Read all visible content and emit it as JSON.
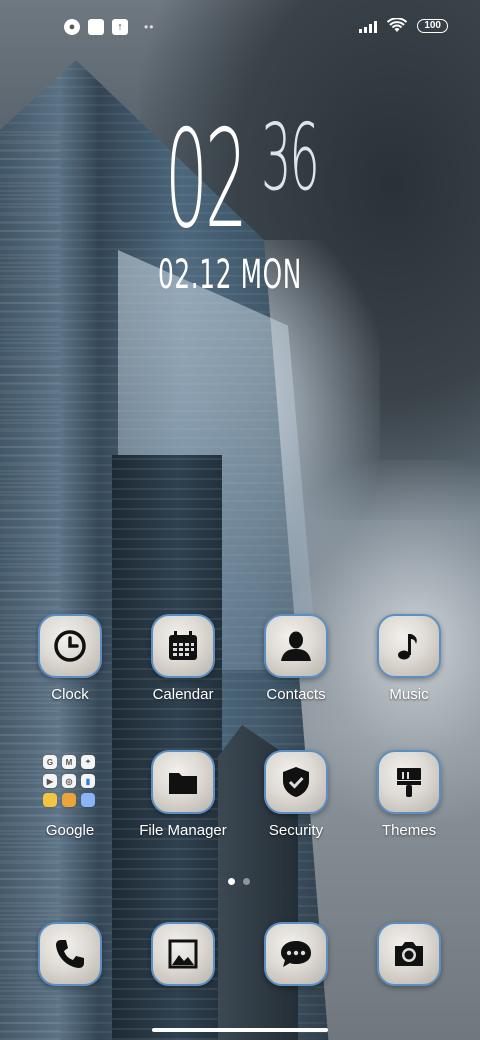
{
  "status": {
    "icons": [
      "app-icon",
      "square-notification-icon",
      "upload-icon",
      "more-dots-icon"
    ],
    "battery": "100"
  },
  "clock": {
    "hours": "02",
    "minutes": "36"
  },
  "date": "02.12 MON",
  "apps": [
    {
      "id": "clock",
      "label": "Clock",
      "icon": "clock-icon"
    },
    {
      "id": "calendar",
      "label": "Calendar",
      "icon": "calendar-icon"
    },
    {
      "id": "contacts",
      "label": "Contacts",
      "icon": "person-icon"
    },
    {
      "id": "music",
      "label": "Music",
      "icon": "music-note-icon"
    },
    {
      "id": "google",
      "label": "Google",
      "icon": "folder-icon"
    },
    {
      "id": "file-manager",
      "label": "File Manager",
      "icon": "folder-icon"
    },
    {
      "id": "security",
      "label": "Security",
      "icon": "shield-icon"
    },
    {
      "id": "themes",
      "label": "Themes",
      "icon": "paintbrush-icon"
    }
  ],
  "dock": [
    {
      "id": "phone",
      "icon": "phone-icon"
    },
    {
      "id": "gallery",
      "icon": "image-icon"
    },
    {
      "id": "messages",
      "icon": "chat-bubble-icon"
    },
    {
      "id": "camera",
      "icon": "camera-icon"
    }
  ],
  "pages": {
    "count": 2,
    "current": 1
  },
  "colors": {
    "icon_border": "#5b8fc2",
    "icon_fill": "#dedad4",
    "glyph": "#111111"
  }
}
